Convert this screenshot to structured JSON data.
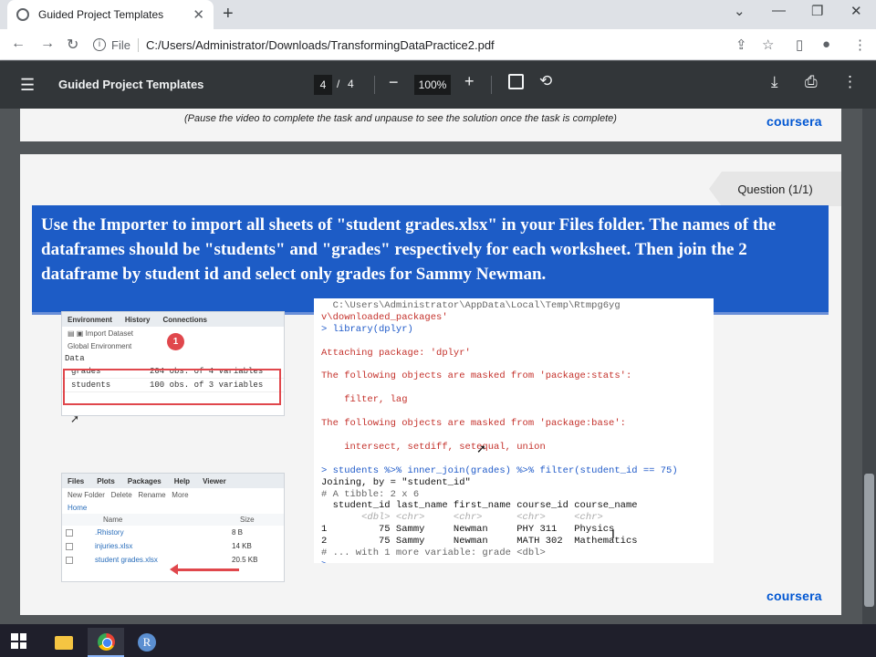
{
  "browser": {
    "tab_title": "Guided Project Templates",
    "tab_close": "✕",
    "new_tab": "+",
    "address_scheme": "File",
    "address_url": "C:/Users/Administrator/Downloads/TransformingDataPractice2.pdf"
  },
  "pdf_toolbar": {
    "title": "Guided Project Templates",
    "current_page": "4",
    "page_separator": "/",
    "total_pages": "4",
    "zoom": "100%"
  },
  "page_top": {
    "note": "(Pause the video to complete the task and unpause to see the solution once the task is complete)",
    "brand": "coursera"
  },
  "page_main": {
    "question_tag": "Question (1/1)",
    "instruction": "Use the Importer to import all sheets of \"student grades.xlsx\" in your Files folder. The names of the dataframes should be \"students\" and \"grades\" respectively for each worksheet. Then join the 2 dataframe by student id and select only grades for Sammy Newman.",
    "brand": "coursera",
    "environment": {
      "tabs": [
        "Environment",
        "History",
        "Connections"
      ],
      "import_label": "Import Dataset",
      "scope": "Global Environment",
      "section": "Data",
      "rows": [
        {
          "name": "grades",
          "desc": "204 obs. of 4 variables"
        },
        {
          "name": "students",
          "desc": "100 obs. of 3 variables"
        }
      ],
      "badge": "1"
    },
    "files": {
      "tabs": [
        "Files",
        "Plots",
        "Packages",
        "Help",
        "Viewer"
      ],
      "new_folder": "New Folder",
      "delete": "Delete",
      "rename": "Rename",
      "more": "More",
      "home": "Home",
      "col_name": "Name",
      "col_size": "Size",
      "rows": [
        {
          "name": ".Rhistory",
          "size": "8 B"
        },
        {
          "name": "injuries.xlsx",
          "size": "14 KB"
        },
        {
          "name": "student grades.xlsx",
          "size": "20.5 KB"
        }
      ]
    },
    "console": {
      "line1": "  C:\\Users\\Administrator\\AppData\\Local\\Temp\\Rtmpg6yg",
      "line2": "v\\downloaded_packages'",
      "line3": "> library(dplyr)",
      "line4": "Attaching package: 'dplyr'",
      "line5": "The following objects are masked from 'package:stats':",
      "line6": "    filter, lag",
      "line7": "The following objects are masked from 'package:base':",
      "line8": "    intersect, setdiff, setequal, union",
      "line9": "> students %>% inner_join(grades) %>% filter(student_id == 75)",
      "line10": "Joining, by = \"student_id\"",
      "line11": "# A tibble: 2 x 6",
      "line12": "  student_id last_name first_name course_id course_name",
      "line13": "       <dbl> <chr>     <chr>      <chr>     <chr>",
      "line14": "1         75 Sammy     Newman     PHY 311   Physics",
      "line15": "2         75 Sammy     Newman     MATH 302  Mathematics",
      "line16": "# ... with 1 more variable: grade <dbl>",
      "line17": ">"
    }
  }
}
